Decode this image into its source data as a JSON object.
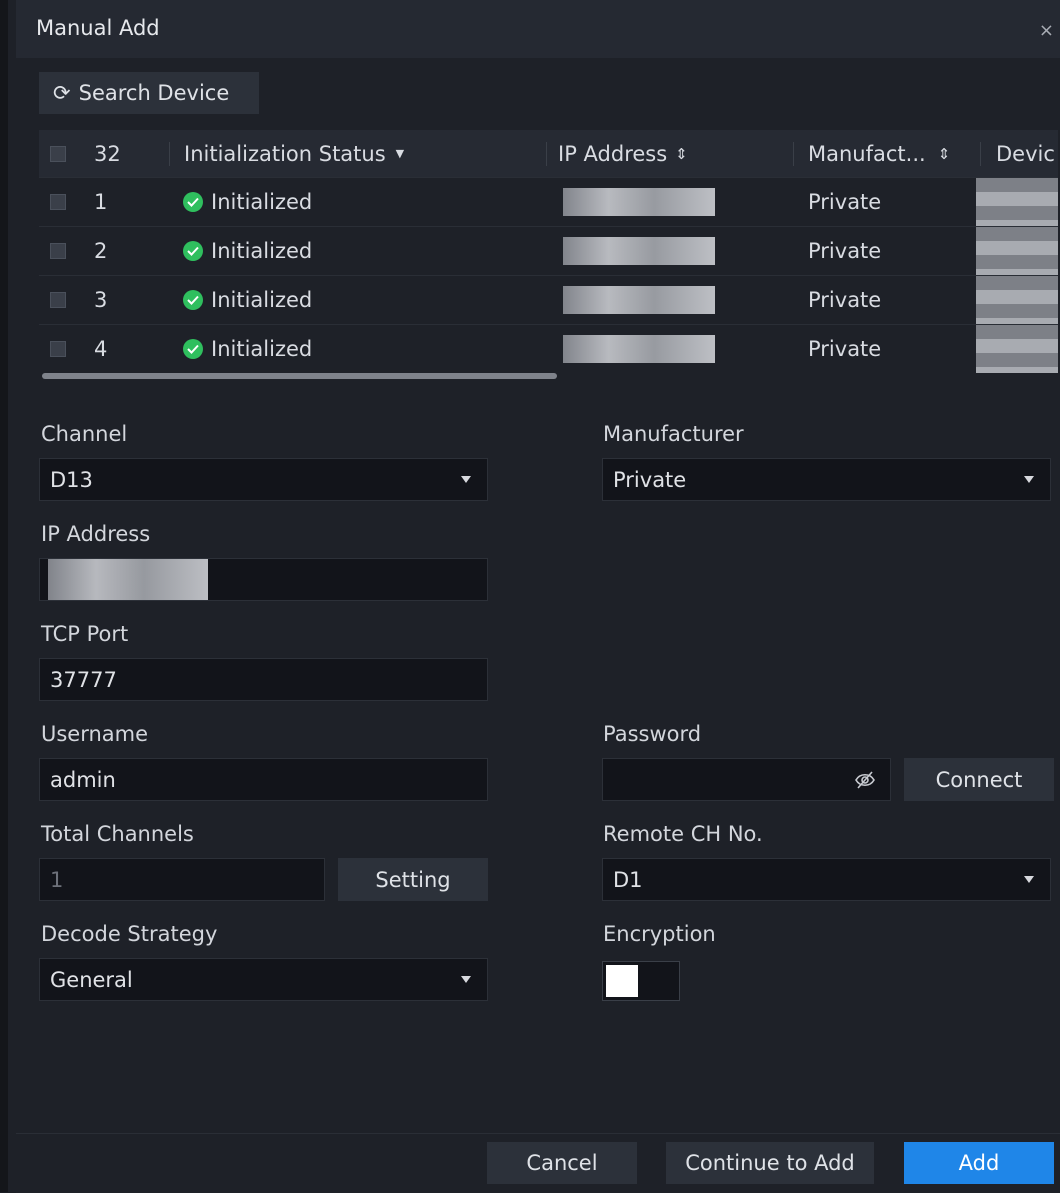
{
  "dialog": {
    "title": "Manual Add",
    "close": "×"
  },
  "toolbar": {
    "search_icon": "⟳",
    "search_label": "Search Device"
  },
  "table": {
    "headers": {
      "count": "32",
      "status": "Initialization Status",
      "status_filter_icon": "▼",
      "ip": "IP Address",
      "ip_sort_icon": "⇕",
      "manufacturer": "Manufact...",
      "manufacturer_sort_icon": "⇕",
      "device": "Devic"
    },
    "rows": [
      {
        "num": "1",
        "status": "Initialized",
        "manufacturer": "Private"
      },
      {
        "num": "2",
        "status": "Initialized",
        "manufacturer": "Private"
      },
      {
        "num": "3",
        "status": "Initialized",
        "manufacturer": "Private"
      },
      {
        "num": "4",
        "status": "Initialized",
        "manufacturer": "Private"
      }
    ]
  },
  "form": {
    "channel": {
      "label": "Channel",
      "value": "D13"
    },
    "manufacturer": {
      "label": "Manufacturer",
      "value": "Private"
    },
    "ip_address": {
      "label": "IP Address"
    },
    "tcp_port": {
      "label": "TCP Port",
      "value": "37777"
    },
    "username": {
      "label": "Username",
      "value": "admin"
    },
    "password": {
      "label": "Password",
      "value": ""
    },
    "connect_label": "Connect",
    "total_channels": {
      "label": "Total Channels",
      "value": "1"
    },
    "setting_label": "Setting",
    "remote_ch": {
      "label": "Remote CH No.",
      "value": "D1"
    },
    "decode_strategy": {
      "label": "Decode Strategy",
      "value": "General"
    },
    "encryption": {
      "label": "Encryption"
    }
  },
  "footer": {
    "cancel": "Cancel",
    "continue": "Continue to Add",
    "add": "Add"
  },
  "colors": {
    "primary": "#1f86e8",
    "status_ok": "#2fbf5e"
  }
}
